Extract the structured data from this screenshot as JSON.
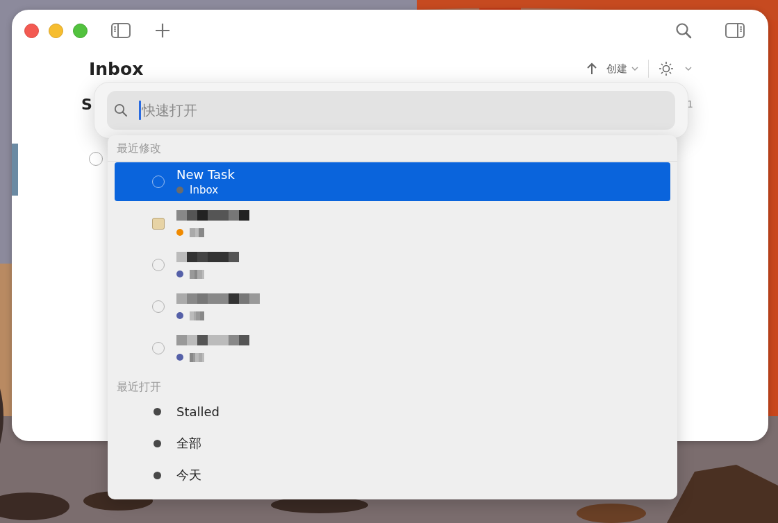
{
  "toolbar": {
    "title": "Inbox",
    "create_label": "创建"
  },
  "behind_popup": {
    "heading_fragment": "S",
    "count": "1"
  },
  "quick_open": {
    "placeholder": "快速打开",
    "sections": [
      {
        "heading": "最近修改",
        "items": [
          {
            "kind": "task",
            "title": "New Task",
            "project": "Inbox",
            "color": "#6b6b6b",
            "selected": true
          },
          {
            "kind": "project",
            "pixelated": true,
            "color": "#f08a00",
            "selected": false
          },
          {
            "kind": "task",
            "pixelated": true,
            "color": "#5560a8",
            "selected": false
          },
          {
            "kind": "task",
            "pixelated": true,
            "color": "#5560a8",
            "selected": false
          },
          {
            "kind": "task",
            "pixelated": true,
            "color": "#5560a8",
            "selected": false
          }
        ]
      },
      {
        "heading": "最近打开",
        "items": [
          {
            "kind": "perspective",
            "title": "Stalled",
            "selected": false
          },
          {
            "kind": "perspective",
            "title": "全部",
            "selected": false
          },
          {
            "kind": "perspective",
            "title": "今天",
            "selected": false
          }
        ]
      }
    ]
  }
}
